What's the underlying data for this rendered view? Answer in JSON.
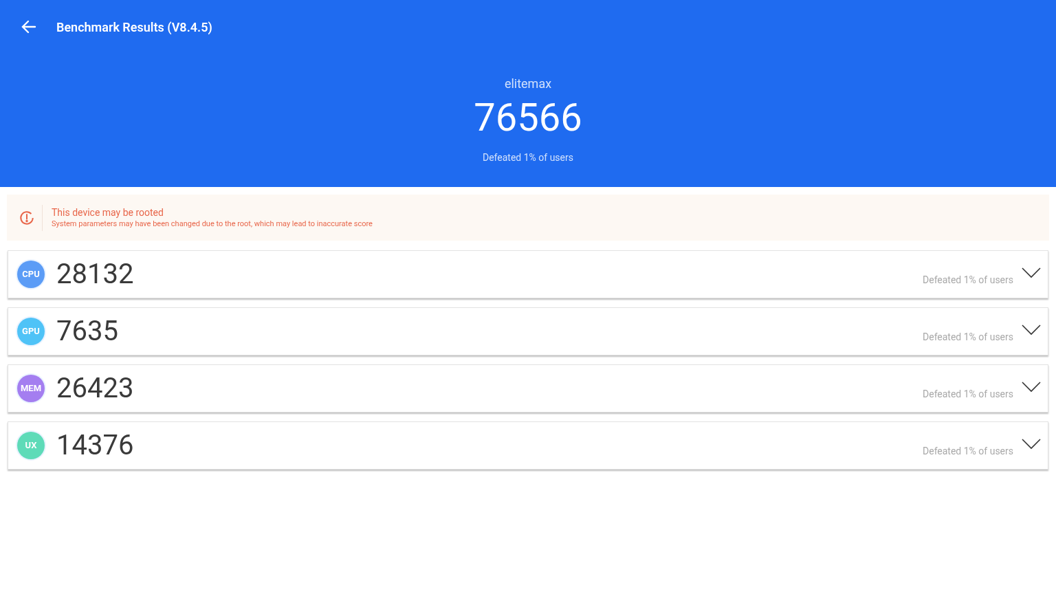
{
  "header": {
    "title": "Benchmark Results (V8.4.5)",
    "device": "elitemax",
    "total_score": "76566",
    "rank": "Defeated 1% of users"
  },
  "warning": {
    "title": "This device may be rooted",
    "message": "System parameters may have been changed due to the root, which may lead to inaccurate score"
  },
  "results": [
    {
      "badge": "CPU",
      "color": "#5b9cf6",
      "score": "28132",
      "rank": "Defeated 1% of users"
    },
    {
      "badge": "GPU",
      "color": "#4fc3f7",
      "score": "7635",
      "rank": "Defeated 1% of users"
    },
    {
      "badge": "MEM",
      "color": "#a47ef0",
      "score": "26423",
      "rank": "Defeated 1% of users"
    },
    {
      "badge": "UX",
      "color": "#5edbb8",
      "score": "14376",
      "rank": "Defeated 1% of users"
    }
  ]
}
